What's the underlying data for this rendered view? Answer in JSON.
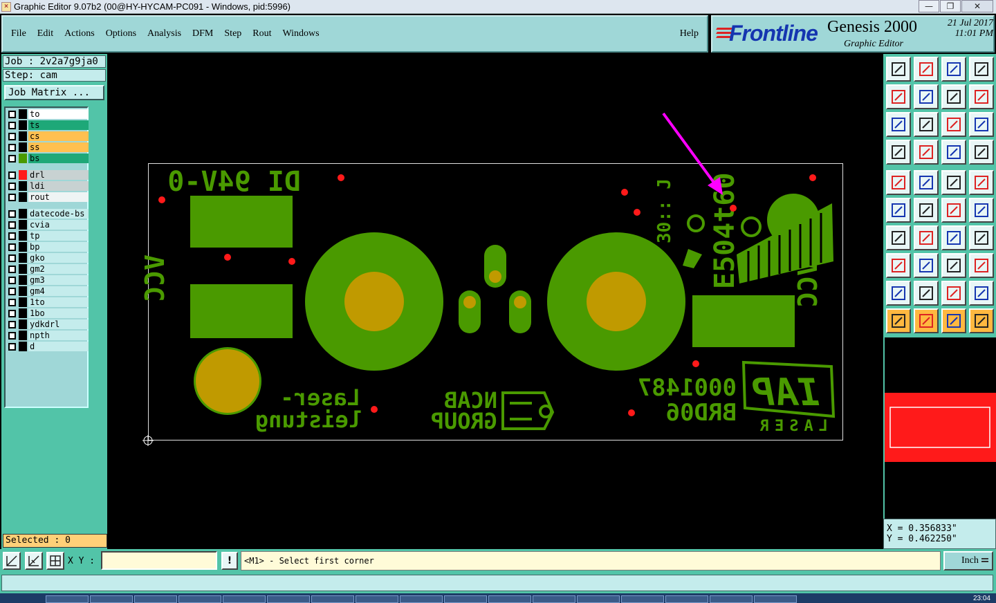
{
  "window": {
    "title": "Graphic Editor 9.07b2 (00@HY-HYCAM-PC091 - Windows, pid:5996)",
    "minimize": "—",
    "maximize": "❐",
    "close": "✕"
  },
  "menu": {
    "items": [
      "File",
      "Edit",
      "Actions",
      "Options",
      "Analysis",
      "DFM",
      "Step",
      "Rout",
      "Windows"
    ],
    "help": "Help"
  },
  "brand": {
    "logo": "Frontline",
    "product": "Genesis 2000",
    "subtitle": "Graphic Editor",
    "date": "21 Jul 2017",
    "time": "11:01 PM"
  },
  "job": {
    "job_label": "Job : 2v2a7g9ja0",
    "step_label": "Step: cam",
    "matrix_button": "Job Matrix ..."
  },
  "layers": [
    {
      "name": "to",
      "bg": "#ffffff",
      "swatch": "#000000",
      "flag": ""
    },
    {
      "name": "ts",
      "bg": "#1ea878",
      "swatch": "#000000",
      "flag": "✎"
    },
    {
      "name": "cs",
      "bg": "#ffc050",
      "swatch": "#000000",
      "flag": "✎"
    },
    {
      "name": "ss",
      "bg": "#ffc050",
      "swatch": "#000000",
      "flag": ""
    },
    {
      "name": "bs",
      "bg": "#1ea878",
      "swatch": "#4a9a00",
      "flag": ""
    },
    {
      "name": "drl",
      "bg": "#c8d2d2",
      "swatch": "#ff1a1a",
      "flag": "⊞"
    },
    {
      "name": "ldi",
      "bg": "#c8d2d2",
      "swatch": "#000000",
      "flag": ""
    },
    {
      "name": "rout",
      "bg": "#eef4f4",
      "swatch": "#000000",
      "flag": ""
    },
    {
      "name": "datecode-bs",
      "bg": "#c4ecec",
      "swatch": "#000000",
      "flag": ""
    },
    {
      "name": "cvia",
      "bg": "#c4ecec",
      "swatch": "#000000",
      "flag": ""
    },
    {
      "name": "tp",
      "bg": "#c4ecec",
      "swatch": "#000000",
      "flag": ""
    },
    {
      "name": "bp",
      "bg": "#c4ecec",
      "swatch": "#000000",
      "flag": ""
    },
    {
      "name": "gko",
      "bg": "#c4ecec",
      "swatch": "#000000",
      "flag": ""
    },
    {
      "name": "gm2",
      "bg": "#c4ecec",
      "swatch": "#000000",
      "flag": ""
    },
    {
      "name": "gm3",
      "bg": "#c4ecec",
      "swatch": "#000000",
      "flag": ""
    },
    {
      "name": "gm4",
      "bg": "#c4ecec",
      "swatch": "#000000",
      "flag": ""
    },
    {
      "name": "1to",
      "bg": "#c4ecec",
      "swatch": "#000000",
      "flag": "✎"
    },
    {
      "name": "1bo",
      "bg": "#c4ecec",
      "swatch": "#000000",
      "flag": ""
    },
    {
      "name": "ydkdrl",
      "bg": "#c4ecec",
      "swatch": "#000000",
      "flag": ""
    },
    {
      "name": "npth",
      "bg": "#c4ecec",
      "swatch": "#000000",
      "flag": ""
    },
    {
      "name": "d",
      "bg": "#c4ecec",
      "swatch": "#000000",
      "flag": ""
    }
  ],
  "selected": "Selected : 0",
  "pcb_text": {
    "top_label": "DI 94V-0",
    "vcc_left": "VCC",
    "vcc_right": "VCC",
    "laser_1": "Laser-",
    "laser_2": "leistung",
    "ncab_1": "NCAB",
    "ncab_2": "GROUP",
    "code_1": "0001487",
    "code_2": "BRD06",
    "iap": "IAP",
    "laser_word": "LASER",
    "datecode": "E504t60",
    "small_code": "30:: J"
  },
  "colors": {
    "copper": "#4a9a00",
    "pad": "#c09a00",
    "drill": "#ff1a1a",
    "arrow": "#ff00ff"
  },
  "coords": {
    "x": "X = 0.356833\"",
    "y": "Y = 0.462250\""
  },
  "bottom": {
    "xy_label": "X Y :",
    "xy_value": "",
    "bang": "!",
    "prompt": "<M1> - Select first corner",
    "units": "Inch"
  },
  "taskbar": {
    "clock": "23:04"
  }
}
